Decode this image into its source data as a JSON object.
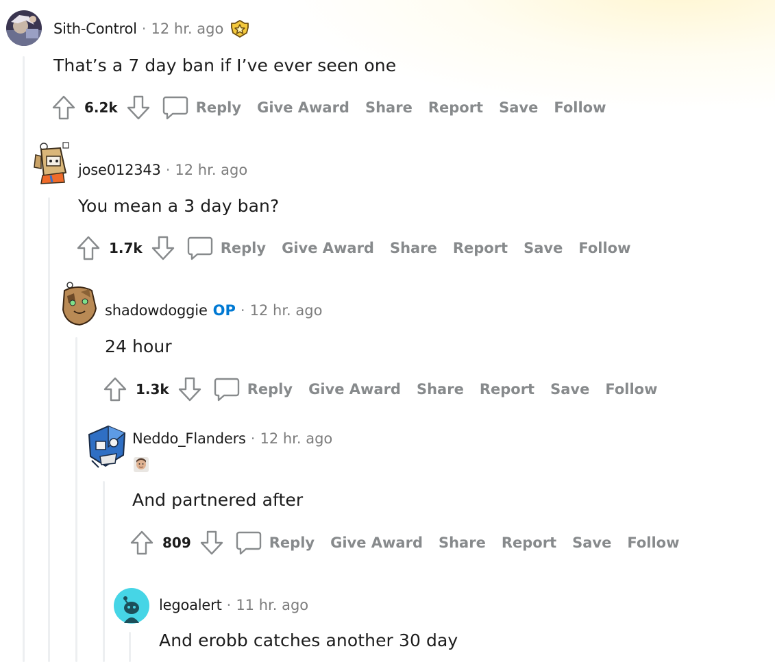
{
  "comments": [
    {
      "username": "Sith-Control",
      "op_label": "",
      "time": "12 hr. ago",
      "body": "That’s a 7 day ban if I’ve ever seen one",
      "score": "6.2k",
      "avatar_icon": "snoo-avatar-dark",
      "has_award": true
    },
    {
      "username": "jose012343",
      "op_label": "",
      "time": "12 hr. ago",
      "body": "You mean a 3 day ban?",
      "score": "1.7k",
      "avatar_icon": "box-robot-avatar"
    },
    {
      "username": "shadowdoggie",
      "op_label": "OP",
      "time": "12 hr. ago",
      "body": "24 hour",
      "score": "1.3k",
      "avatar_icon": "furry-avatar"
    },
    {
      "username": "Neddo_Flanders",
      "op_label": "",
      "time": "12 hr. ago",
      "body": "And partnered after",
      "score": "809",
      "avatar_icon": "blue-robot-avatar",
      "flair_icon": "user-flair-icon"
    },
    {
      "username": "legoalert",
      "op_label": "",
      "time": "11 hr. ago",
      "body": "And erobb catches another 30 day",
      "avatar_icon": "default-snoo-avatar"
    }
  ],
  "actions": {
    "reply": "Reply",
    "give_award": "Give Award",
    "share": "Share",
    "report": "Report",
    "save": "Save",
    "follow": "Follow"
  },
  "colors": {
    "op": "#0079d3",
    "muted": "#878a8c",
    "thread_line": "#edeff1",
    "default_avatar_bg": "#46d5e6"
  }
}
